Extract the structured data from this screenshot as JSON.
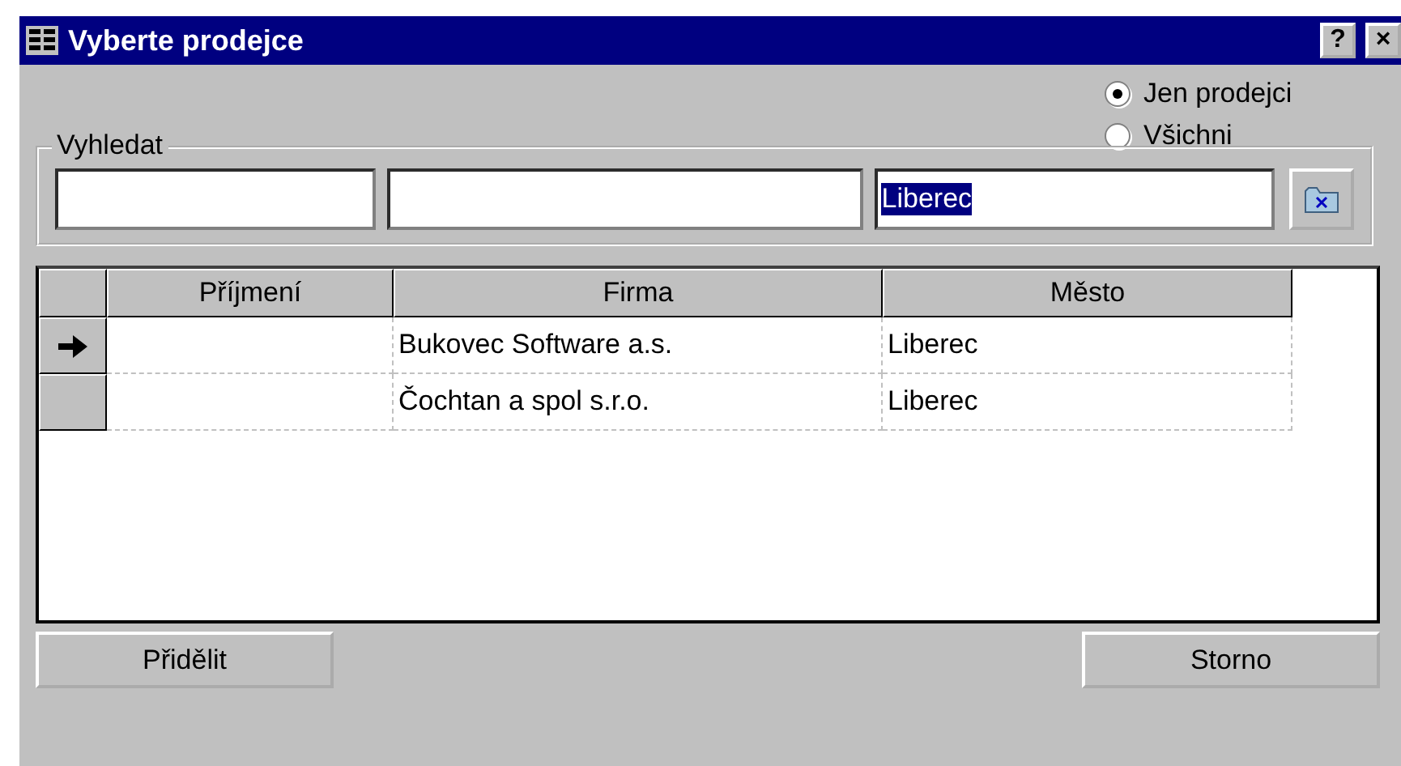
{
  "window": {
    "title": "Vyberte prodejce",
    "help_button": "?",
    "close_button": "×"
  },
  "filter_options": [
    {
      "label": "Jen prodejci",
      "selected": true
    },
    {
      "label": "Všichni",
      "selected": false
    }
  ],
  "search": {
    "label": "Vyhledat",
    "fields": [
      {
        "kind": "text"
      },
      {
        "kind": "text"
      },
      {
        "kind": "text",
        "value": "Liberec",
        "selected_text": true
      }
    ]
  },
  "table": {
    "columns": [
      "Příjmení",
      "Firma",
      "Město"
    ],
    "rows": [
      {
        "cells": [
          "",
          "Bukovec Software a.s.",
          "Liberec"
        ],
        "selected": true
      },
      {
        "cells": [
          "",
          "Čochtan a spol s.r.o.",
          "Liberec"
        ],
        "selected": false
      }
    ]
  },
  "buttons": [
    "Přidělit",
    "Storno"
  ]
}
